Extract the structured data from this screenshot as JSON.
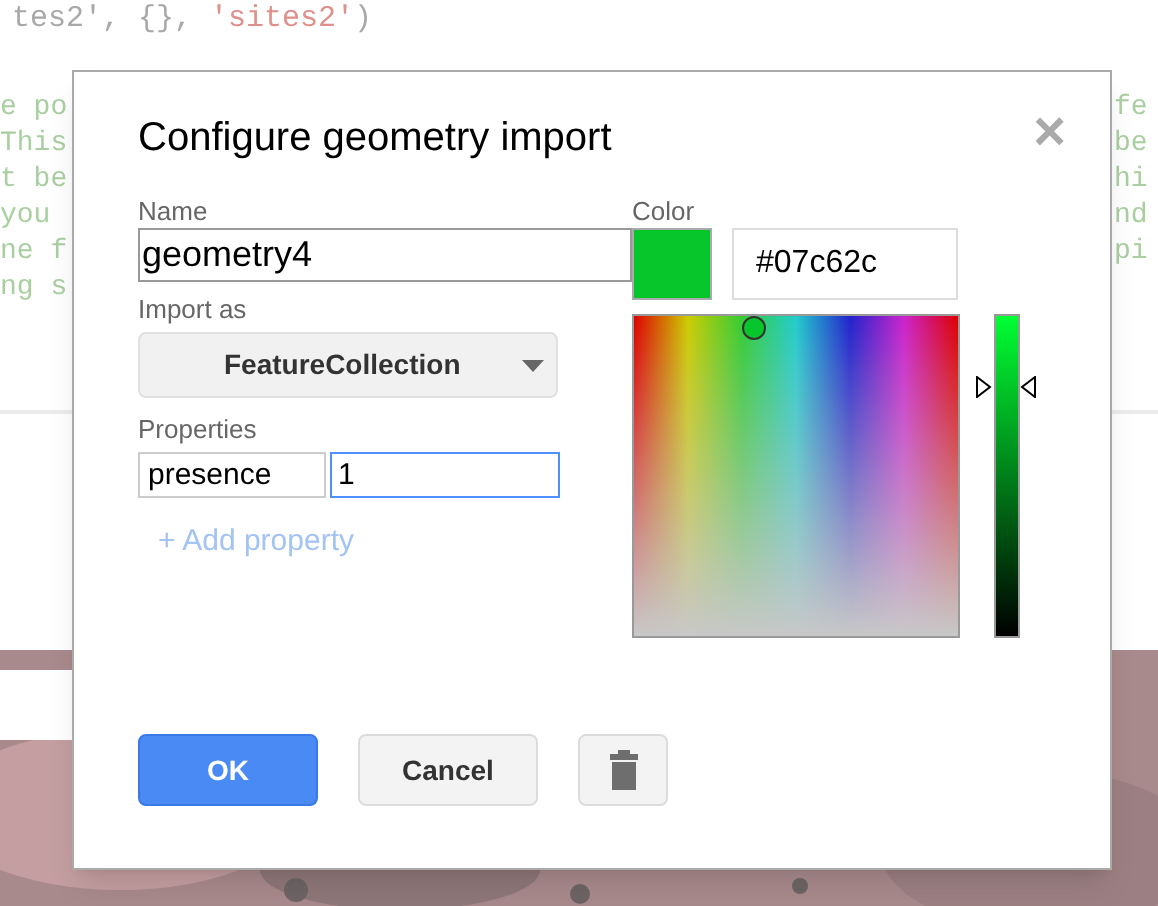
{
  "editor": {
    "top_line": [
      {
        "kind": "code",
        "text": "tes2', {}, "
      },
      {
        "kind": "string",
        "text": "'sites2'"
      },
      {
        "kind": "code",
        "text": ")"
      }
    ],
    "left_fragments": [
      "e po",
      "This",
      "t be",
      "you",
      "ne f",
      "ng s"
    ],
    "right_fragments": [
      "fe",
      "be",
      "hi",
      "nd",
      "pi"
    ]
  },
  "dialog": {
    "title": "Configure geometry import",
    "close": "×",
    "name": {
      "label": "Name",
      "value": "geometry4"
    },
    "import_as": {
      "label": "Import as",
      "value": "FeatureCollection"
    },
    "properties": {
      "label": "Properties",
      "rows": [
        {
          "key": "presence",
          "value": "1",
          "focused": true
        }
      ],
      "add": "+ Add property"
    },
    "color": {
      "label": "Color",
      "color": "#07c62c",
      "hex": "#07c62c",
      "brightness": {
        "level": 0.77
      }
    },
    "buttons": [
      {
        "kind": "primary",
        "label": "OK"
      },
      {
        "kind": "secondary",
        "label": "Cancel"
      },
      {
        "kind": "delete"
      }
    ]
  }
}
